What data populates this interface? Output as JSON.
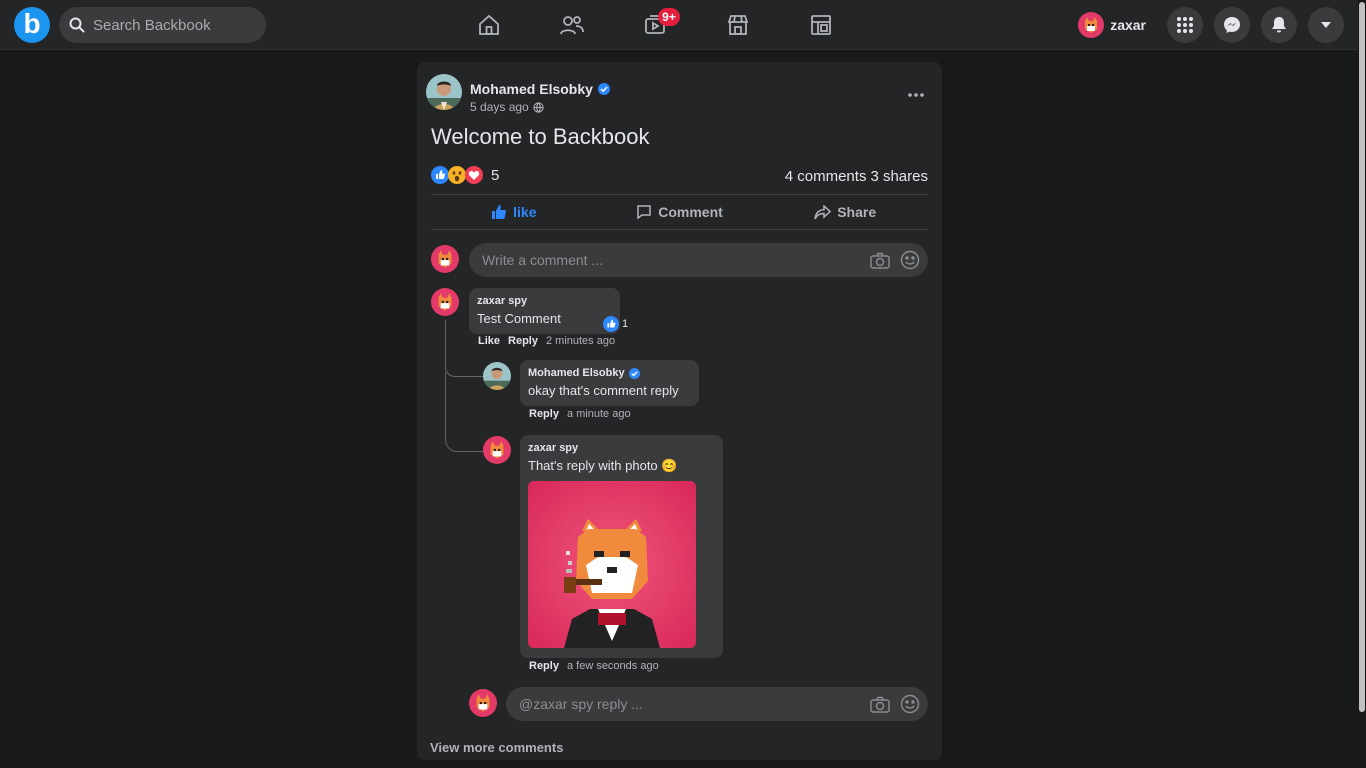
{
  "app": {
    "logo_letter": "b",
    "brand_color": "#1b95f0"
  },
  "search": {
    "placeholder": "Search Backbook"
  },
  "nav": {
    "items": [
      {
        "name": "home-icon"
      },
      {
        "name": "friends-icon"
      },
      {
        "name": "watch-icon",
        "badge": "9+"
      },
      {
        "name": "marketplace-icon"
      },
      {
        "name": "groups-icon"
      }
    ]
  },
  "user": {
    "name": "zaxar"
  },
  "post": {
    "author": "Mohamed Elsobky",
    "verified": true,
    "time": "5 days ago",
    "text": "Welcome to Backbook",
    "reactions": {
      "types": [
        "like",
        "wow",
        "love"
      ],
      "count": "5"
    },
    "comments_count": "4 comments",
    "shares_count": "3 shares",
    "actions": {
      "like": "like",
      "comment": "Comment",
      "share": "Share"
    },
    "comment_placeholder": "Write a comment ...",
    "comments": [
      {
        "author": "zaxar spy",
        "text": "Test Comment",
        "likes": "1",
        "like_label": "Like",
        "reply_label": "Reply",
        "time": "2 minutes ago",
        "replies": [
          {
            "author": "Mohamed Elsobky",
            "verified": true,
            "text": "okay that's comment reply",
            "reply_label": "Reply",
            "time": "a minute ago"
          },
          {
            "author": "zaxar spy",
            "text": "That's reply with photo 😊",
            "reply_label": "Reply",
            "time": "a few seconds ago",
            "has_photo": true
          }
        ],
        "reply_placeholder": "@zaxar spy reply ..."
      }
    ],
    "view_more": "View more comments"
  }
}
